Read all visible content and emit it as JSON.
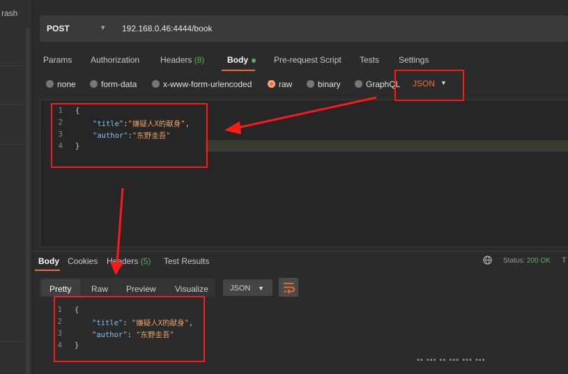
{
  "sidebar": {
    "label": "rash"
  },
  "request": {
    "method": "POST",
    "url": "192.168.0.46:4444/book"
  },
  "request_tabs": [
    {
      "label": "Params"
    },
    {
      "label": "Authorization"
    },
    {
      "label": "Headers",
      "count": "(8)"
    },
    {
      "label": "Body"
    },
    {
      "label": "Pre-request Script"
    },
    {
      "label": "Tests"
    },
    {
      "label": "Settings"
    }
  ],
  "body_types": [
    "none",
    "form-data",
    "x-www-form-urlencoded",
    "raw",
    "binary",
    "GraphQL"
  ],
  "body_format": "JSON",
  "request_body": {
    "line_numbers": [
      "1",
      "2",
      "3",
      "4"
    ],
    "open": "{",
    "close": "}",
    "key1": "\"title\"",
    "val1": "\"嫌疑人X的献身\"",
    "key2": "\"author\"",
    "val2": "\"东野圭吾\""
  },
  "response_tabs": [
    {
      "label": "Body"
    },
    {
      "label": "Cookies"
    },
    {
      "label": "Headers",
      "count": "(5)"
    },
    {
      "label": "Test Results"
    }
  ],
  "status": {
    "label": "Status:",
    "value": "200 OK",
    "more": "T"
  },
  "view_modes": [
    "Pretty",
    "Raw",
    "Preview",
    "Visualize"
  ],
  "response_format": "JSON",
  "response_body": {
    "line_numbers": [
      "1",
      "2",
      "3",
      "4"
    ],
    "open": "{",
    "close": "}",
    "key1": "\"title\"",
    "val1": "\"嫌疑人X的献身\"",
    "key2": "\"author\"",
    "val2": "\"东野圭吾\""
  },
  "colors": {
    "accent": "#f26b3a",
    "success": "#55b35a",
    "annotation": "#ff1a1a"
  },
  "icons": [
    "globe-icon",
    "wrap-lines-icon",
    "chevron-down-icon"
  ]
}
